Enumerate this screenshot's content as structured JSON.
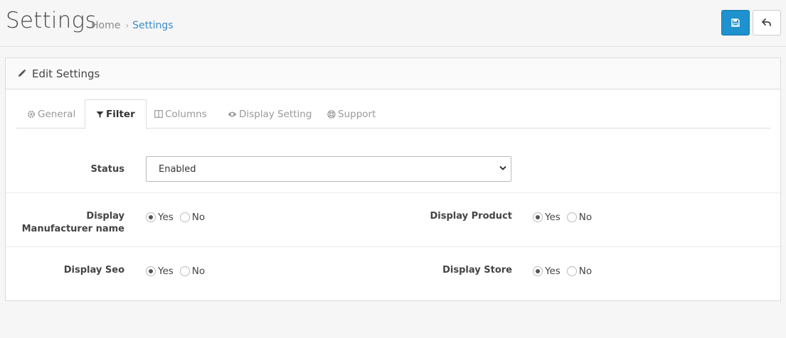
{
  "header": {
    "title": "Settings",
    "breadcrumb": [
      {
        "label": "Home"
      },
      {
        "label": "Settings"
      }
    ],
    "breadcrumb_separator": "›",
    "save_icon": "floppy-disk-icon",
    "back_icon": "reply-arrow-icon"
  },
  "panel": {
    "heading_icon": "pencil-icon",
    "heading": "Edit Settings"
  },
  "tabs": [
    {
      "label": "General",
      "icon": "gear-icon",
      "active": false
    },
    {
      "label": "Filter",
      "icon": "filter-icon",
      "active": true
    },
    {
      "label": "Columns",
      "icon": "columns-icon",
      "active": false
    },
    {
      "label": "Display Setting",
      "icon": "eye-icon",
      "active": false
    },
    {
      "label": "Support",
      "icon": "lifebuoy-icon",
      "active": false
    }
  ],
  "form": {
    "status": {
      "label": "Status",
      "value": "Enabled"
    },
    "display_manufacturer": {
      "label": "Display Manufacturer name",
      "value": "Yes"
    },
    "display_product": {
      "label": "Display Product",
      "value": "Yes"
    },
    "display_seo": {
      "label": "Display Seo",
      "value": "Yes"
    },
    "display_store": {
      "label": "Display Store",
      "value": "Yes"
    },
    "options": {
      "yes": "Yes",
      "no": "No"
    }
  },
  "colors": {
    "accent": "#1e91cf",
    "link": "#3a8dcb"
  }
}
